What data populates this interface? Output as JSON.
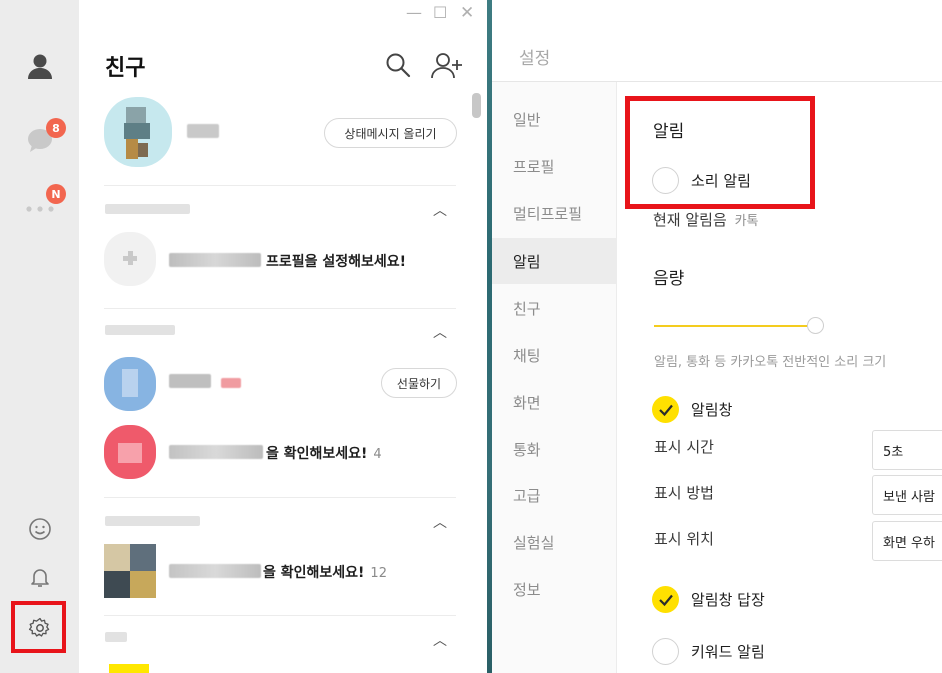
{
  "rail": {
    "chat_badge": "8",
    "more_badge": "N"
  },
  "friends": {
    "title": "친구",
    "my_profile": {
      "status_button": "상태메시지 올리기"
    },
    "rows": [
      {
        "text": "프로필을 설정해보세요!",
        "count": ""
      },
      {
        "text": "",
        "count": "",
        "button": "선물하기"
      },
      {
        "text": "을 확인해보세요!",
        "count": "4"
      },
      {
        "text": "을 확인해보세요!",
        "count": "12"
      }
    ]
  },
  "settings": {
    "title": "설정",
    "categories": [
      "일반",
      "프로필",
      "멀티프로필",
      "알림",
      "친구",
      "채팅",
      "화면",
      "통화",
      "고급",
      "실험실",
      "정보"
    ],
    "active_category": "알림",
    "notification": {
      "heading": "알림",
      "sound_label": "소리 알림",
      "current_sound_label": "현재 알림음",
      "current_sound_value": "카톡"
    },
    "volume": {
      "heading": "음량",
      "level": 0.9,
      "description": "알림, 통화 등 카카오톡 전반적인 소리 크기"
    },
    "popup": {
      "label": "알림창",
      "checked": true,
      "display_time_label": "표시 시간",
      "display_time_value": "5초",
      "display_method_label": "표시 방법",
      "display_method_value": "보낸 사람",
      "display_position_label": "표시 위치",
      "display_position_value": "화면 우하"
    },
    "popup_reply": {
      "label": "알림창 답장",
      "checked": true
    },
    "keyword": {
      "label": "키워드 알림",
      "checked": false
    }
  },
  "colors": {
    "highlight": "#e8141a",
    "badge": "#f2664f",
    "toggle_on": "#ffe000",
    "rail_bg": "#ececec"
  }
}
